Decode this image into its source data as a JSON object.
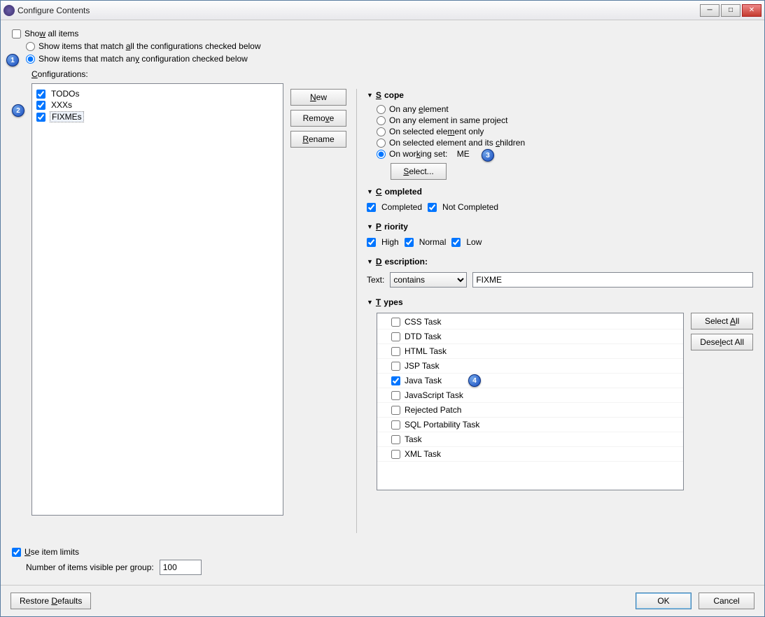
{
  "window": {
    "title": "Configure Contents"
  },
  "top": {
    "show_all": "Show all items",
    "match_all": "Show items that match all the configurations checked below",
    "match_any": "Show items that match any configuration checked below",
    "configurations_label": "Configurations:"
  },
  "config_items": [
    {
      "label": "TODOs",
      "checked": true
    },
    {
      "label": "XXXs",
      "checked": true
    },
    {
      "label": "FIXMEs",
      "checked": true,
      "selected": true
    }
  ],
  "buttons": {
    "new": "New",
    "remove": "Remove",
    "rename": "Rename"
  },
  "scope": {
    "header": "Scope",
    "any_element": "On any element",
    "same_project": "On any element in same project",
    "selected_only": "On selected element only",
    "selected_children": "On selected element and its children",
    "working_set": "On working set:",
    "working_set_name": "ME",
    "select": "Select..."
  },
  "completed": {
    "header": "Completed",
    "completed": "Completed",
    "not_completed": "Not Completed"
  },
  "priority": {
    "header": "Priority",
    "high": "High",
    "normal": "Normal",
    "low": "Low"
  },
  "description": {
    "header": "Description:",
    "text_label": "Text:",
    "combo_value": "contains",
    "value": "FIXME"
  },
  "types": {
    "header": "Types",
    "select_all": "Select All",
    "deselect_all": "Deselect All",
    "items": [
      {
        "label": "CSS Task",
        "checked": false
      },
      {
        "label": "DTD Task",
        "checked": false
      },
      {
        "label": "HTML Task",
        "checked": false
      },
      {
        "label": "JSP Task",
        "checked": false
      },
      {
        "label": "Java Task",
        "checked": true
      },
      {
        "label": "JavaScript Task",
        "checked": false
      },
      {
        "label": "Rejected Patch",
        "checked": false
      },
      {
        "label": "SQL Portability Task",
        "checked": false
      },
      {
        "label": "Task",
        "checked": false
      },
      {
        "label": "XML Task",
        "checked": false
      }
    ]
  },
  "limits": {
    "use_limits": "Use item limits",
    "per_group_label": "Number of items visible per group:",
    "value": "100"
  },
  "footer": {
    "restore": "Restore Defaults",
    "ok": "OK",
    "cancel": "Cancel"
  },
  "badges": {
    "b1": "1",
    "b2": "2",
    "b3": "3",
    "b4": "4"
  }
}
